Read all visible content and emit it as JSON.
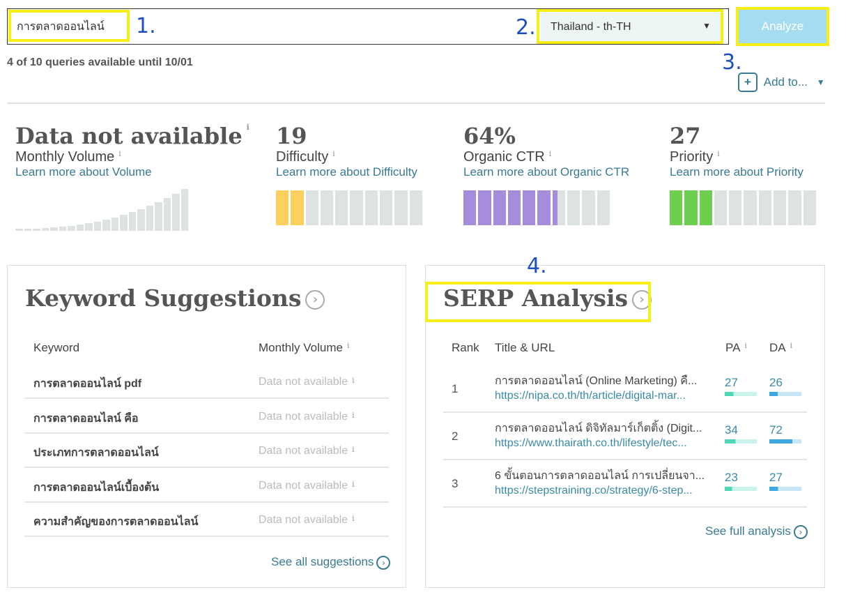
{
  "search": {
    "keyword": "การตลาดออนไลน์",
    "locale": "Thailand - th-TH",
    "analyze_label": "Analyze",
    "quota": "4 of 10 queries available until 10/01",
    "add_to_label": "Add to..."
  },
  "annotations": [
    "1.",
    "2.",
    "3.",
    "4."
  ],
  "metrics": [
    {
      "value": "Data not available",
      "label": "Monthly Volume",
      "link": "Learn more about Volume",
      "bars": "volume-history-no-data"
    },
    {
      "value": "19",
      "label": "Difficulty",
      "link": "Learn more about Difficulty",
      "filled_segments": 2,
      "total_segments": 10,
      "color": "#fdcf5f"
    },
    {
      "value": "64%",
      "label": "Organic CTR",
      "link": "Learn more about Organic CTR",
      "filled_segments": 6.4,
      "total_segments": 10,
      "color": "#a58ddb"
    },
    {
      "value": "27",
      "label": "Priority",
      "link": "Learn more about Priority",
      "filled_segments": 3,
      "total_segments": 10,
      "color": "#6ccf4e"
    }
  ],
  "keywords": {
    "title": "Keyword Suggestions",
    "col_keyword": "Keyword",
    "col_volume": "Monthly Volume",
    "see_all": "See all suggestions",
    "rows": [
      {
        "keyword": "การตลาดออนไลน์ pdf",
        "volume": "Data not available"
      },
      {
        "keyword": "การตลาดออนไลน์ คือ",
        "volume": "Data not available"
      },
      {
        "keyword": "ประเภทการตลาดออนไลน์",
        "volume": "Data not available"
      },
      {
        "keyword": "การตลาดออนไลน์เบื้องต้น",
        "volume": "Data not available"
      },
      {
        "keyword": "ความสำคัญของการตลาดออนไลน์",
        "volume": "Data not available"
      }
    ]
  },
  "serp": {
    "title": "SERP Analysis",
    "col_rank": "Rank",
    "col_title": "Title & URL",
    "col_pa": "PA",
    "col_da": "DA",
    "see_full": "See full analysis",
    "rows": [
      {
        "rank": "1",
        "title": "การตลาดออนไลน์ (Online Marketing) คื...",
        "url": "https://nipa.co.th/th/article/digital-mar...",
        "pa": "27",
        "da": "26"
      },
      {
        "rank": "2",
        "title": "การตลาดออนไลน์ ดิจิทัลมาร์เก็ตติ้ง (Digit...",
        "url": "https://www.thairath.co.th/lifestyle/tec...",
        "pa": "34",
        "da": "72"
      },
      {
        "rank": "3",
        "title": "6 ขั้นตอนการตลาดออนไลน์ การเปลี่ยนจา...",
        "url": "https://stepstraining.co/strategy/6-step...",
        "pa": "23",
        "da": "27"
      }
    ]
  },
  "colors": {
    "pa": "#4fd8b8",
    "da": "#3ea8e0",
    "pa_bg": "#c9f3ea",
    "da_bg": "#c6e8f6",
    "annotation": "#1d4fc4",
    "highlight": "#f7ee16"
  }
}
